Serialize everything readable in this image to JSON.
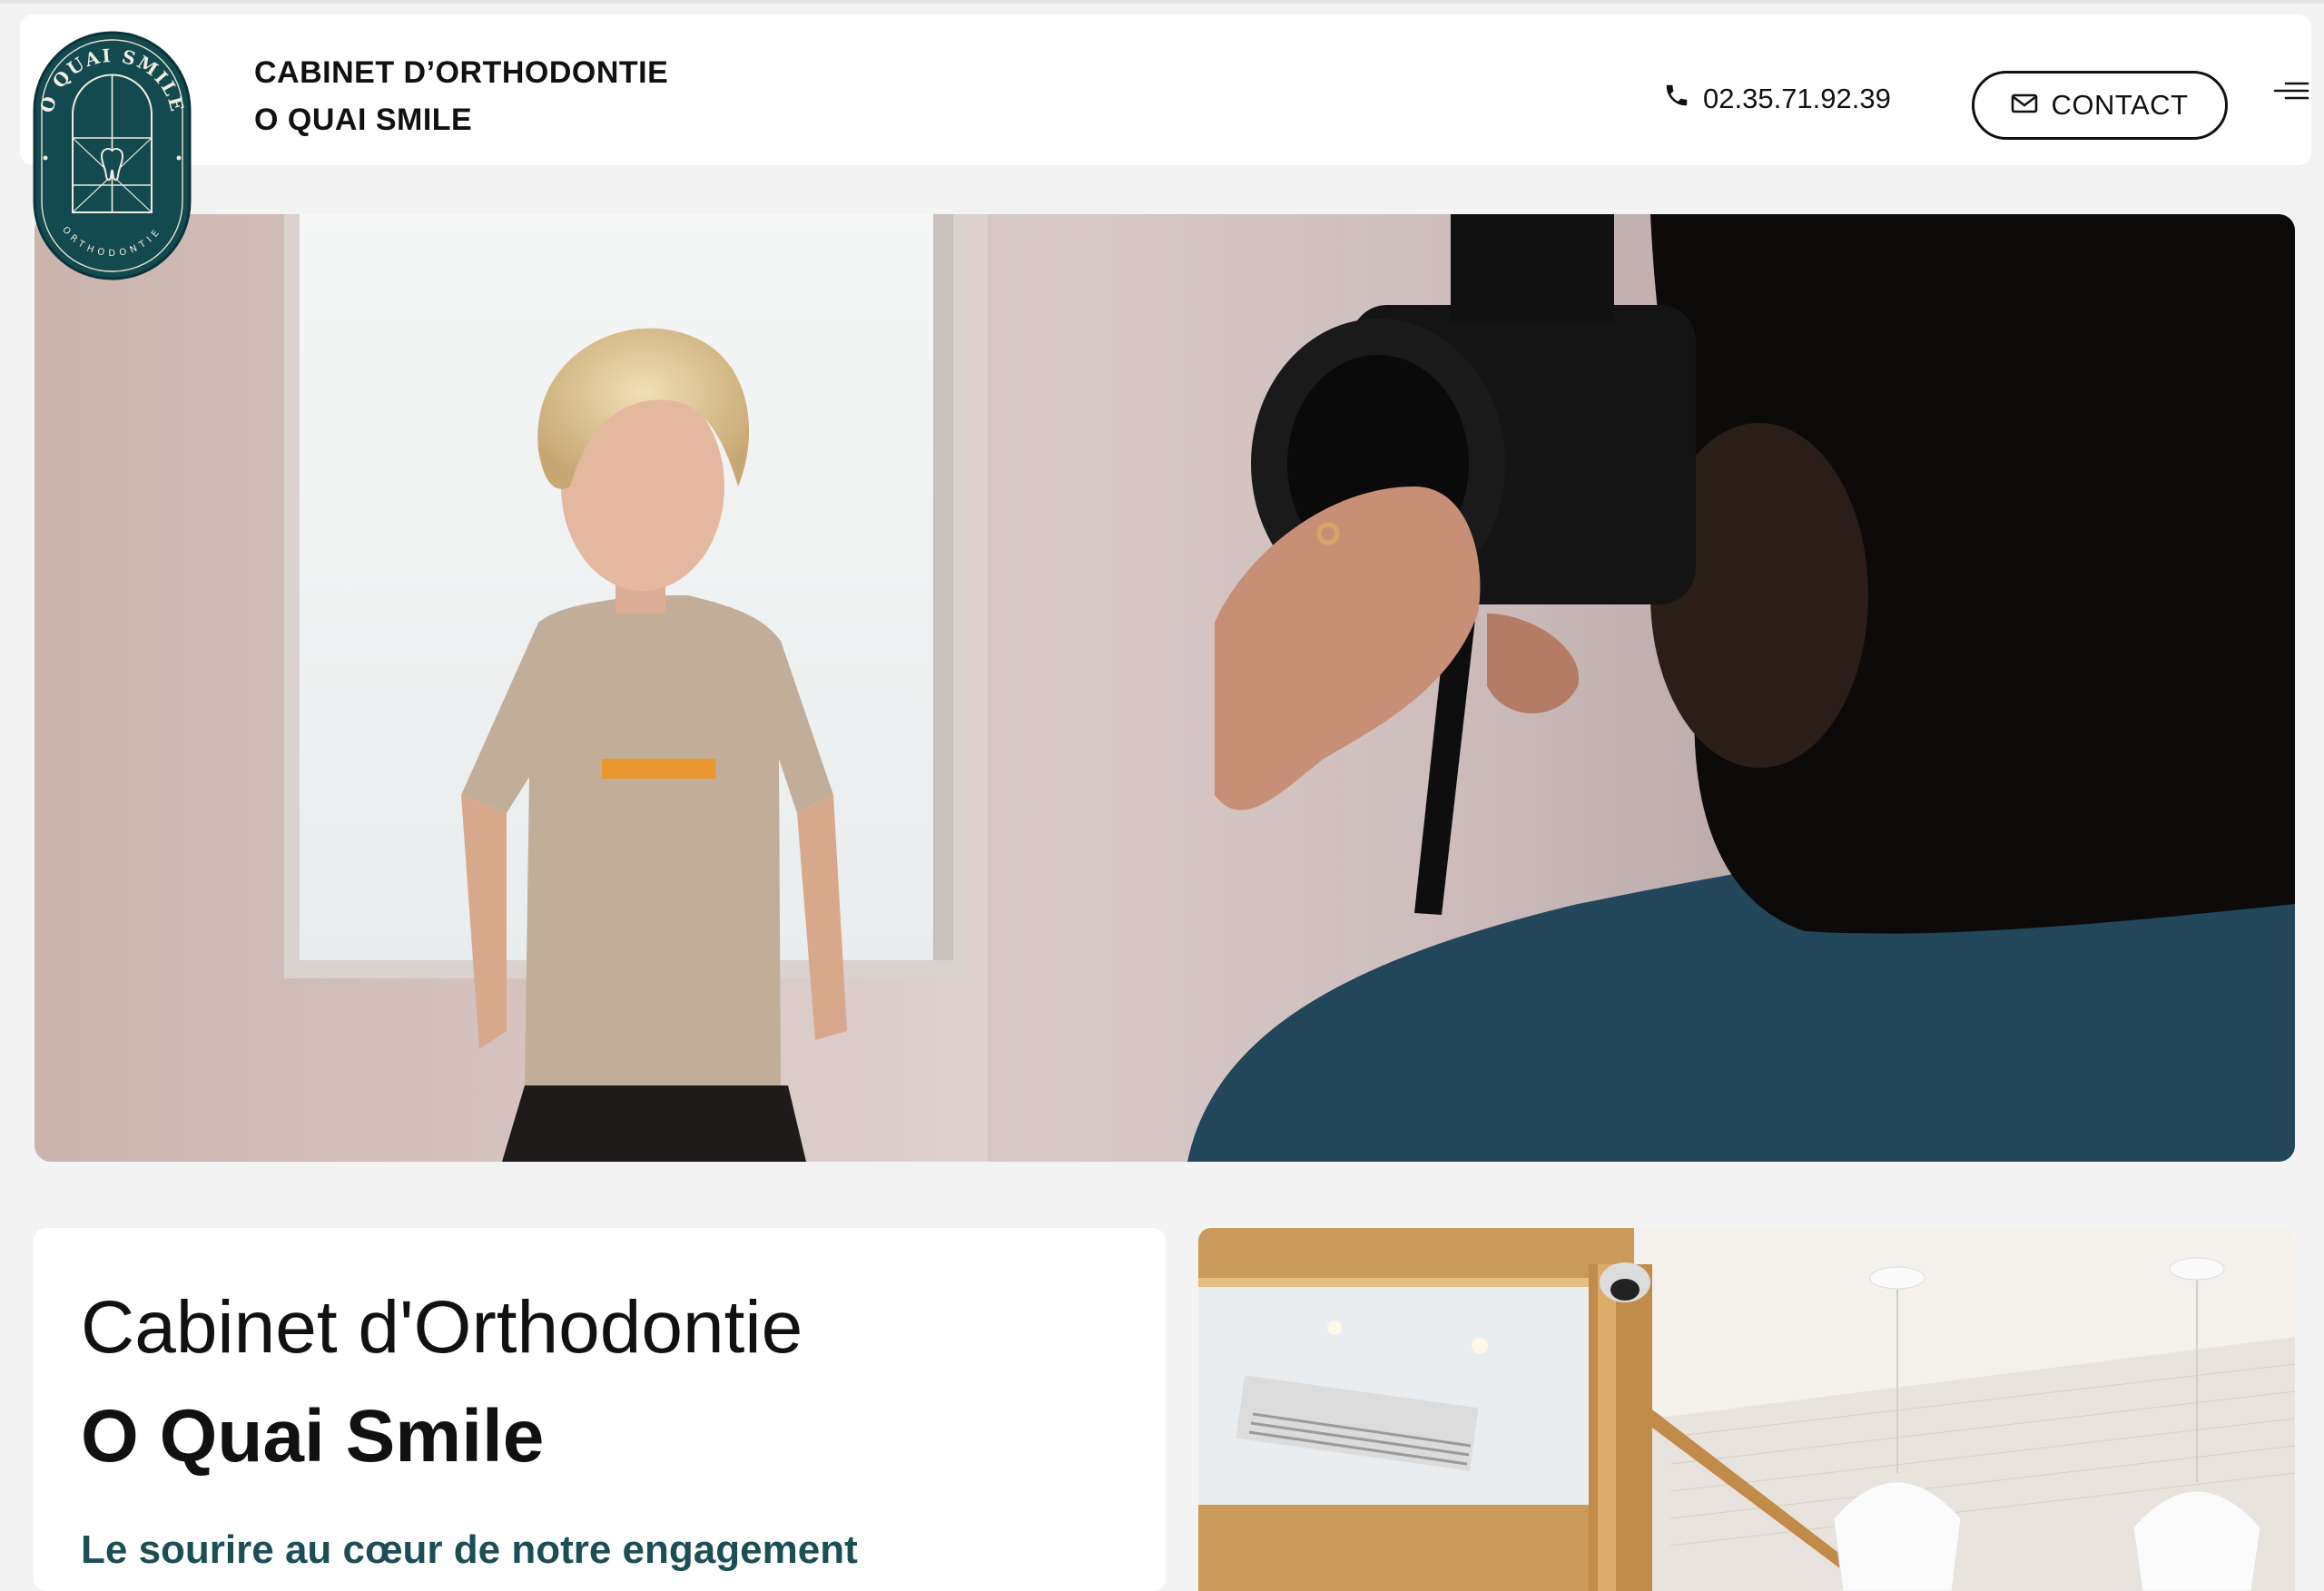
{
  "header": {
    "brand_line1": "CABINET D’ORTHODONTIE",
    "brand_line2": "O QUAI SMILE",
    "phone": "02.35.71.92.39",
    "contact_label": "CONTACT",
    "logo": {
      "arc_text_top": "O QUAI SMILE",
      "arc_text_bottom": "ORTHODONTIE"
    }
  },
  "intro": {
    "title_light": "Cabinet d'Orthodontie",
    "title_bold": "O Quai Smile",
    "tagline": "Le sourire au cœur de notre engagement"
  },
  "colors": {
    "brand_green": "#124a4f",
    "accent_gold": "#c9a66b",
    "background": "#f3f3f3"
  },
  "icons": {
    "phone": "phone-icon",
    "contact": "envelope-icon",
    "menu": "hamburger-menu-icon"
  }
}
